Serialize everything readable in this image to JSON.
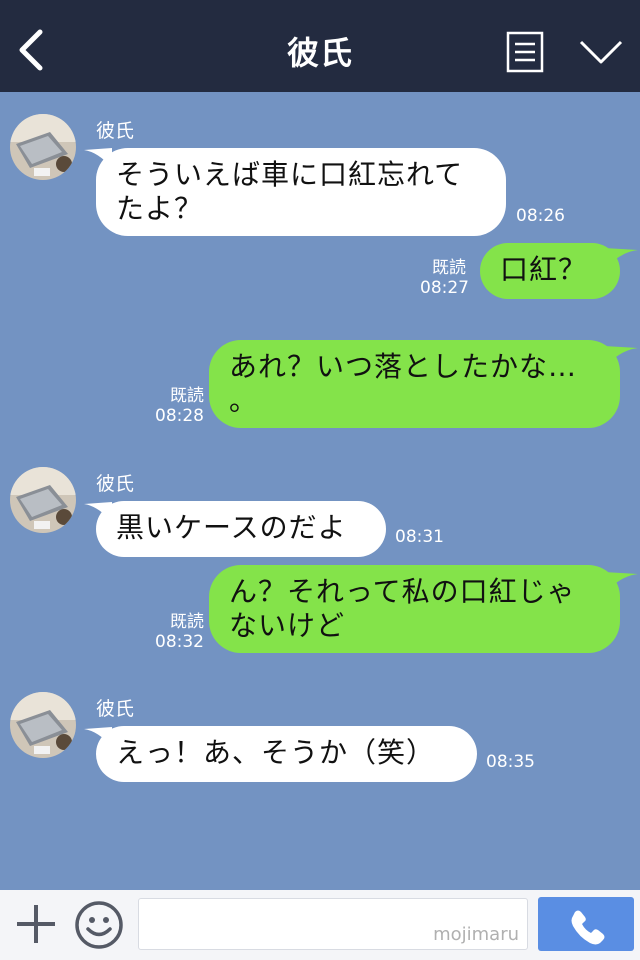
{
  "header": {
    "title": "彼氏"
  },
  "messages": [
    {
      "side": "in",
      "sender": "彼氏",
      "lines": [
        "そういえば車に口紅忘れて",
        "たよ？"
      ],
      "time": "08:26"
    },
    {
      "side": "out",
      "read": "既読",
      "lines": [
        "口紅？"
      ],
      "time": "08:27"
    },
    {
      "side": "out",
      "read": "既読",
      "lines": [
        "あれ？いつ落としたかな…",
        "。"
      ],
      "time": "08:28"
    },
    {
      "side": "in",
      "sender": "彼氏",
      "lines": [
        "黒いケースのだよ"
      ],
      "time": "08:31"
    },
    {
      "side": "out",
      "read": "既読",
      "lines": [
        "ん？それって私の口紅じゃ",
        "ないけど"
      ],
      "time": "08:32"
    },
    {
      "side": "in",
      "sender": "彼氏",
      "lines": [
        "えっ！あ、そうか（笑）"
      ],
      "time": "08:35"
    }
  ],
  "footer": {
    "input_value": "",
    "watermark": "mojimaru"
  },
  "colors": {
    "chat_bg": "#7393c2",
    "header_bg": "#232b40",
    "bubble_out": "#84e34a",
    "bubble_in": "#ffffff",
    "call_button": "#5a8ee3"
  },
  "icons": [
    "back-arrow-icon",
    "menu-icon",
    "chevron-down-icon",
    "plus-icon",
    "emoji-icon",
    "phone-icon"
  ]
}
